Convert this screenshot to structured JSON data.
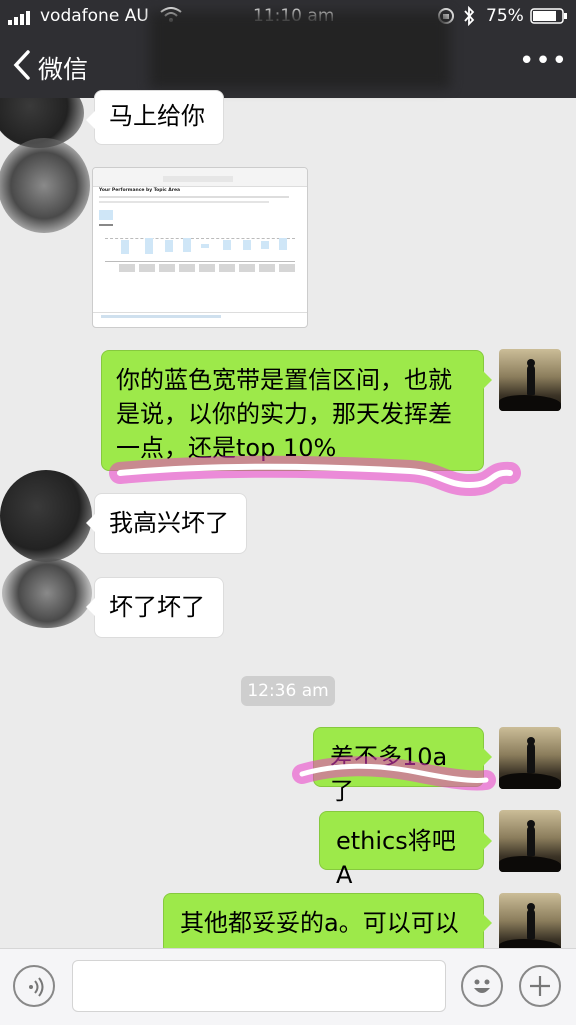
{
  "status_bar": {
    "carrier": "vodafone AU",
    "time": "11:10 am",
    "battery": "75%"
  },
  "nav_bar": {
    "back_label": "微信",
    "more_label": "•••"
  },
  "messages": [
    {
      "side": "left",
      "text": "马上给你"
    },
    {
      "side": "left",
      "type": "image",
      "caption": "Your Performance by Topic Area"
    },
    {
      "side": "right",
      "text": "你的蓝色宽带是置信区间，也就是说，以你的实力，那天发挥差一点，还是top 10%"
    },
    {
      "side": "left",
      "text": "我高兴坏了"
    },
    {
      "side": "left",
      "text": "坏了坏了"
    },
    {
      "side": "right",
      "text": "差不多10a了"
    },
    {
      "side": "right",
      "text": "ethics将吧A"
    },
    {
      "side": "right",
      "text": "其他都妥妥的a。可以可以"
    }
  ],
  "timestamp": "12:36 am",
  "colors": {
    "bar_bg": "#2f2f33",
    "chat_bg": "#ebebeb",
    "bubble_green": "#9de94a",
    "highlight_pink": "#eb3cc8"
  }
}
